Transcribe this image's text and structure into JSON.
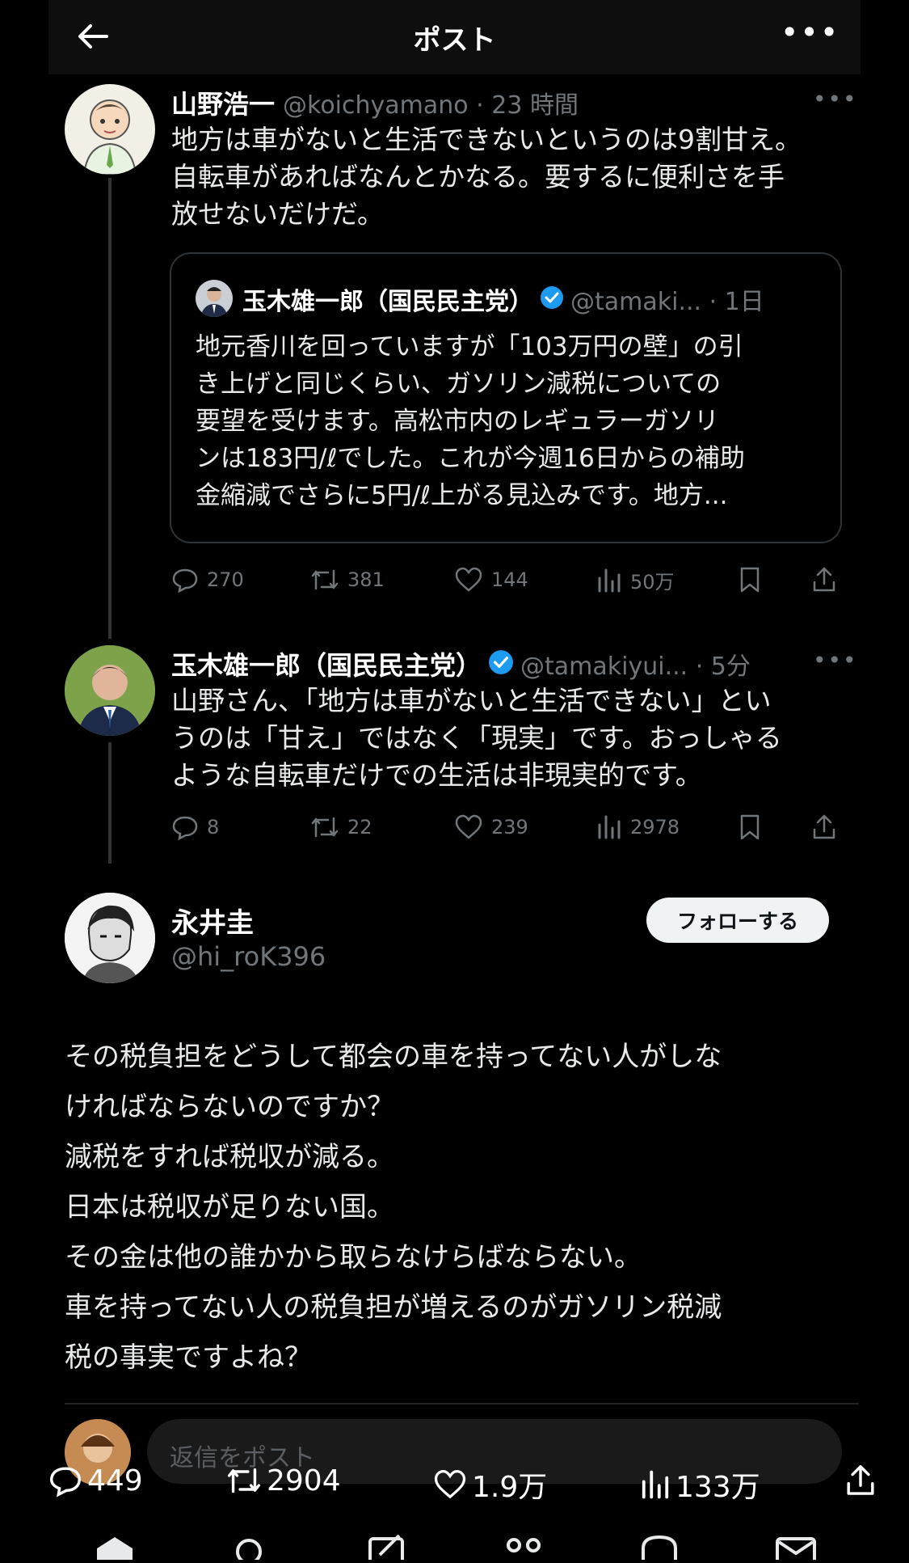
{
  "header": {
    "title": "ポスト",
    "more": "•••"
  },
  "tweet1": {
    "name": "山野浩一",
    "handle": "@koichyamano · 23 時間",
    "more": "•••",
    "lines": [
      "地方は車がないと生活できないというのは9割甘え。",
      "自転車があればなんとかなる。要するに便利さを手",
      "放せないだけだ。"
    ],
    "quote": {
      "name": "玉木雄一郎（国民民主党）",
      "handle": "@tamaki... · 1日",
      "lines": [
        "地元香川を回っていますが「103万円の壁」の引",
        "き上げと同じくらい、ガソリン減税についての",
        "要望を受けます。高松市内のレギュラーガソリ",
        "ンは183円/ℓでした。これが今週16日からの補助",
        "金縮減でさらに5円/ℓ上がる見込みです。地方..."
      ]
    },
    "actions": {
      "replies": "270",
      "retweets": "381",
      "likes": "144",
      "views": "50万"
    }
  },
  "tweet2": {
    "name": "玉木雄一郎（国民民主党）",
    "handle": "@tamakiyui... · 5分",
    "more": "•••",
    "lines": [
      "山野さん、「地方は車がないと生活できない」とい",
      "うのは「甘え」ではなく「現実」です。おっしゃる",
      "ような自転車だけでの生活は非現実的です。"
    ],
    "actions": {
      "replies": "8",
      "retweets": "22",
      "likes": "239",
      "views": "2978"
    }
  },
  "main": {
    "name": "永井圭",
    "handle": "@hi_roK396",
    "follow": "フォローする",
    "lines": [
      "その税負担をどうして都会の車を持ってない人がしな",
      "ければならないのですか？",
      "減税をすれば税収が減る。",
      "日本は税収が足りない国。",
      "その金は他の誰かから取らなけらばならない。",
      "車を持ってない人の税負担が増えるのがガソリン税減",
      "税の事実ですよね？"
    ],
    "reply_placeholder": "返信をポスト",
    "actions": {
      "replies": "449",
      "retweets": "2904",
      "likes": "1.9万",
      "views": "133万"
    }
  },
  "colors": {
    "verified": "#1d9bf0",
    "muted": "#71767b"
  }
}
